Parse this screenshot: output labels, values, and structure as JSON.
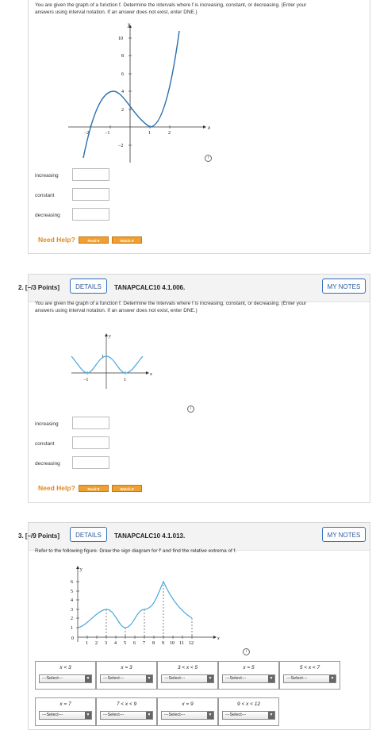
{
  "q1": {
    "prompt_line1": "You are given the graph of a function f. Determine the intervals where f is increasing, constant, or decreasing. (Enter your",
    "prompt_line2": "answers using interval notation. If an answer does not exist, enter DNE.)",
    "graph": {
      "ylabel": "y",
      "xlabel": "x",
      "xticks": [
        "−2",
        "−1",
        "1",
        "2"
      ],
      "yticks": [
        "10",
        "8",
        "6",
        "4",
        "2",
        "−2"
      ]
    },
    "fields": [
      {
        "label": "increasing",
        "value": ""
      },
      {
        "label": "constant",
        "value": ""
      },
      {
        "label": "decreasing",
        "value": ""
      }
    ],
    "need_help": "Need Help?",
    "read_it": "Read It",
    "watch_it": "Watch It",
    "info_glyph": "i"
  },
  "q2": {
    "number": "2.",
    "points": "[–/3 Points]",
    "details": "DETAILS",
    "ref": "TANAPCALC10 4.1.006.",
    "my_notes": "MY NOTES",
    "prompt_line1": "You are given the graph of a function f. Determine the intervals where f is increasing, constant, or decreasing. (Enter your",
    "prompt_line2": "answers using interval notation. If an answer does not exist, enter DNE.)",
    "graph": {
      "ylabel": "y",
      "xlabel": "x",
      "xticks": [
        "−1",
        "1"
      ],
      "yticks": [
        "1"
      ]
    },
    "fields": [
      {
        "label": "increasing",
        "value": ""
      },
      {
        "label": "constant",
        "value": ""
      },
      {
        "label": "decreasing",
        "value": ""
      }
    ],
    "need_help": "Need Help?",
    "read_it": "Read It",
    "watch_it": "Watch It",
    "info_glyph": "i"
  },
  "q3": {
    "number": "3.",
    "points": "[–/9 Points]",
    "details": "DETAILS",
    "ref": "TANAPCALC10 4.1.013.",
    "my_notes": "MY NOTES",
    "prompt": "Refer to the following figure. Draw the sign diagram for f′ and find the relative extrema of f.",
    "graph": {
      "ylabel": "y",
      "xlabel": "x",
      "xticks": [
        "1",
        "2",
        "3",
        "4",
        "5",
        "6",
        "7",
        "8",
        "9",
        "10",
        "11",
        "12"
      ],
      "yticks": [
        "6",
        "5",
        "4",
        "3",
        "2",
        "1"
      ],
      "origin": "0"
    },
    "cells_row1": [
      {
        "title": "x < 3",
        "select": "---Select---"
      },
      {
        "title": "x = 3",
        "select": "---Select---"
      },
      {
        "title": "3 < x < 5",
        "select": "---Select---"
      },
      {
        "title": "x = 5",
        "select": "---Select---"
      },
      {
        "title": "5 < x < 7",
        "select": "---Select---"
      }
    ],
    "cells_row2": [
      {
        "title": "x = 7",
        "select": "---Select---"
      },
      {
        "title": "7 < x < 9",
        "select": "---Select---"
      },
      {
        "title": "x = 9",
        "select": "---Select---"
      },
      {
        "title": "9 < x < 12",
        "select": "---Select---"
      }
    ],
    "select_arrow": "▼",
    "info_glyph": "i"
  }
}
